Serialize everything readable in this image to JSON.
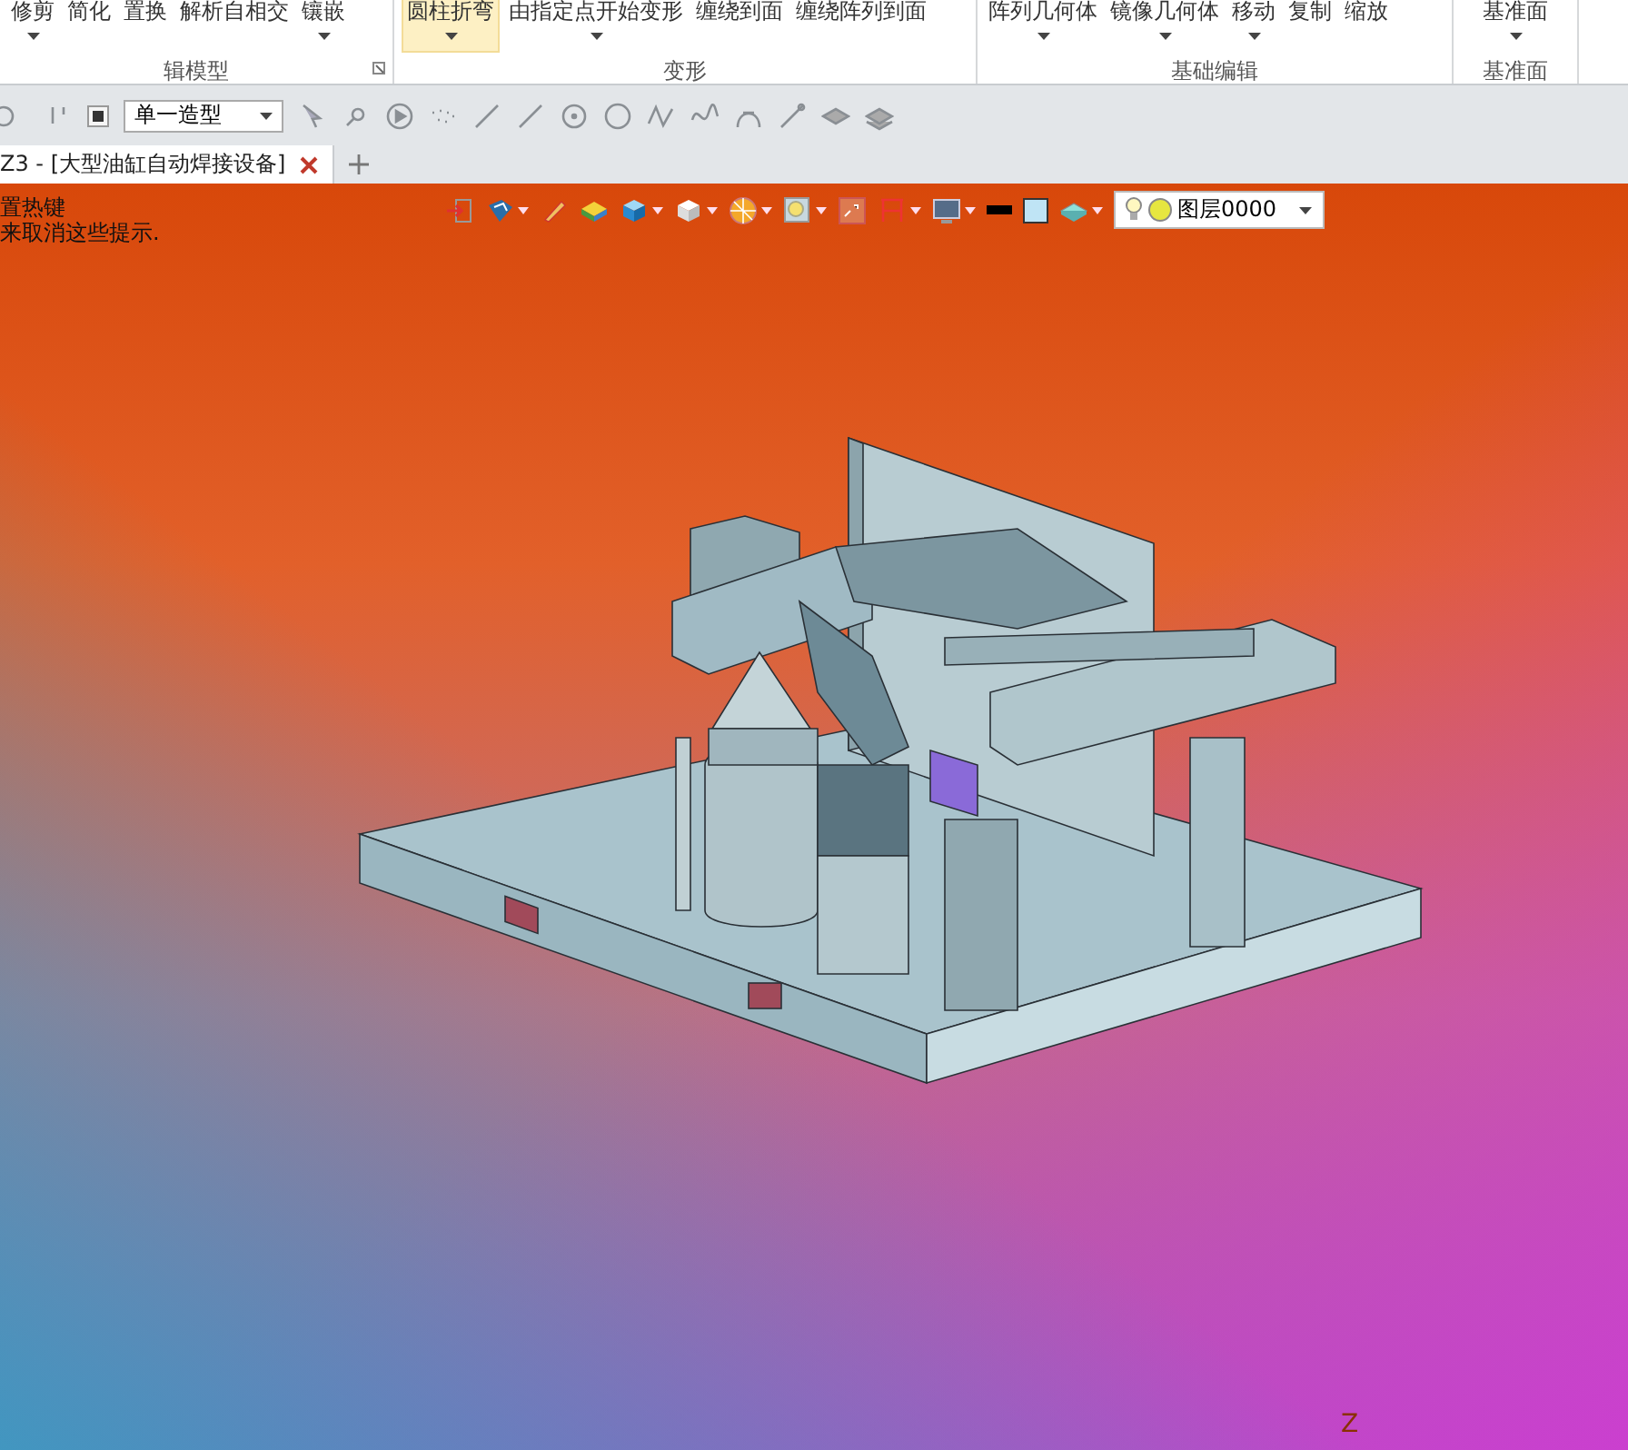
{
  "ribbon": {
    "groups": [
      {
        "label": "辑模型",
        "launcher": true,
        "buttons": [
          {
            "label": "修剪",
            "dropdown": true,
            "selected": false
          },
          {
            "label": "简化",
            "dropdown": false,
            "selected": false
          },
          {
            "label": "置换",
            "dropdown": false,
            "selected": false
          },
          {
            "label": "解析自相交",
            "dropdown": false,
            "selected": false
          },
          {
            "label": "镶嵌",
            "dropdown": true,
            "selected": false
          }
        ]
      },
      {
        "label": "变形",
        "launcher": false,
        "buttons": [
          {
            "label": "圆柱折弯",
            "dropdown": true,
            "selected": true
          },
          {
            "label": "由指定点开始变形",
            "dropdown": true,
            "selected": false
          },
          {
            "label": "缠绕到面",
            "dropdown": false,
            "selected": false
          },
          {
            "label": "缠绕阵列到面",
            "dropdown": false,
            "selected": false
          }
        ]
      },
      {
        "label": "基础编辑",
        "launcher": false,
        "buttons": [
          {
            "label": "阵列几何体",
            "dropdown": true,
            "selected": false
          },
          {
            "label": "镜像几何体",
            "dropdown": true,
            "selected": false
          },
          {
            "label": "移动",
            "dropdown": true,
            "selected": false
          },
          {
            "label": "复制",
            "dropdown": false,
            "selected": false
          },
          {
            "label": "缩放",
            "dropdown": false,
            "selected": false
          }
        ]
      },
      {
        "label": "基准面",
        "launcher": false,
        "buttons": [
          {
            "label": "基准面",
            "dropdown": true,
            "selected": false
          }
        ]
      }
    ]
  },
  "toolbar": {
    "filter": "单一造型"
  },
  "document_tabs": [
    {
      "label": "Z3 - [大型油缸自动焊接设备]",
      "selected": true
    }
  ],
  "viewport": {
    "hints": [
      "置热键",
      "来取消这些提示."
    ],
    "layer": "图层0000",
    "axis_label": "Z"
  }
}
